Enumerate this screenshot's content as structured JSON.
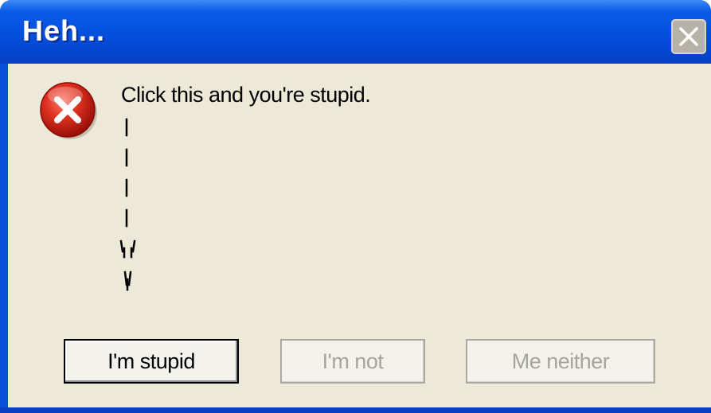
{
  "window": {
    "title": "Heh...",
    "close_icon": "close-icon"
  },
  "dialog": {
    "icon": "error-icon",
    "message": "Click this and you're stupid.",
    "arrow_icon": "down-arrow-icon"
  },
  "buttons": [
    {
      "label": "I'm stupid",
      "enabled": true
    },
    {
      "label": "I'm not",
      "enabled": false
    },
    {
      "label": "Me neither",
      "enabled": false
    }
  ],
  "colors": {
    "titlebar": "#0553e1",
    "client": "#ece9d8",
    "error_red": "#d62a1e",
    "disabled_text": "#a6a59a"
  }
}
